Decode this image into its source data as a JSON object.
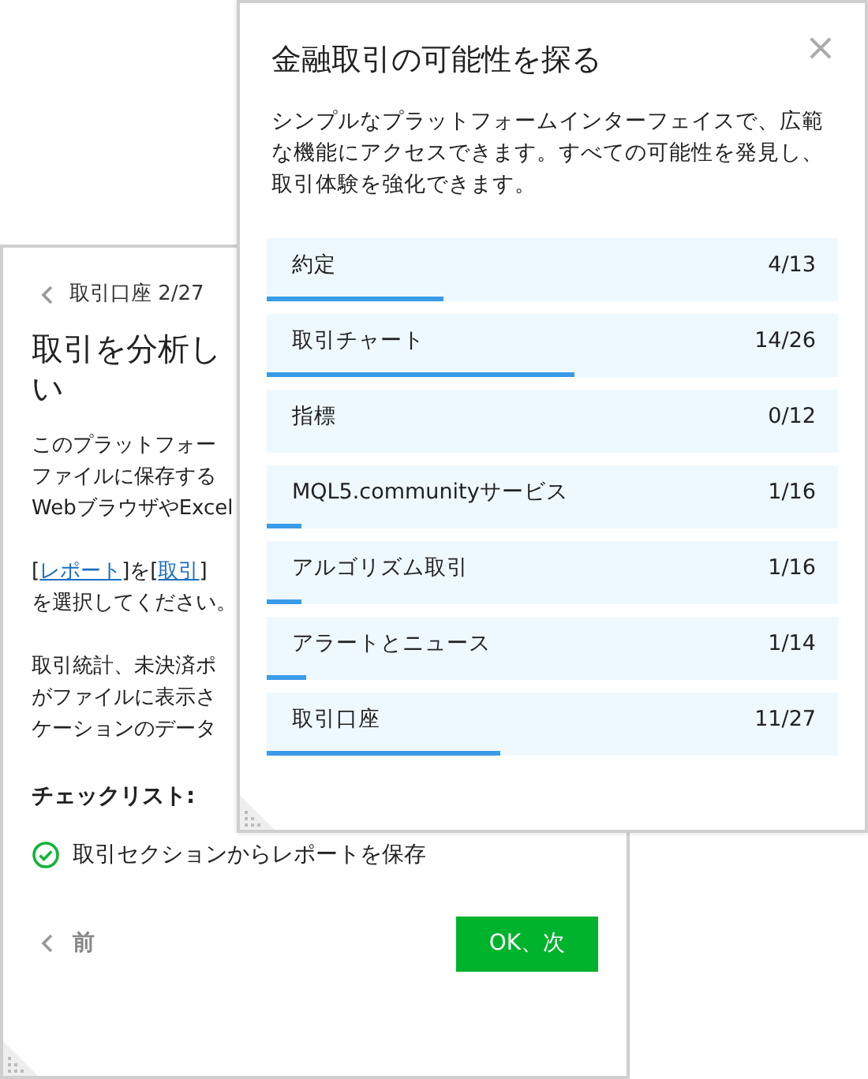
{
  "back_dialog": {
    "breadcrumb": "取引口座 2/27",
    "title_lines": [
      "取引を分析し",
      "い"
    ],
    "paragraphs": [
      {
        "lines": [
          [
            {
              "text": "このプラットフォー"
            }
          ],
          [
            {
              "text": "ファイルに保存する"
            }
          ],
          [
            {
              "text": "WebブラウザやExcel"
            }
          ]
        ]
      },
      {
        "lines": [
          [
            {
              "text": "["
            },
            {
              "text": "レポート",
              "kind": "link"
            },
            {
              "text": "]を["
            },
            {
              "text": "取引",
              "kind": "link"
            },
            {
              "text": "]"
            }
          ],
          [
            {
              "text": "を選択してください。"
            }
          ]
        ]
      },
      {
        "lines": [
          [
            {
              "text": "取引統計、未決済ポ"
            }
          ],
          [
            {
              "text": "がファイルに表示さ"
            }
          ],
          [
            {
              "text": "ケーションのデータ"
            }
          ]
        ]
      }
    ],
    "checklist_title": "チェックリスト:",
    "checklist": [
      {
        "label": "取引セクションからレポートを保存",
        "checked": true
      }
    ],
    "prev_button": "前",
    "next_button": "OK、次"
  },
  "front_dialog": {
    "title": "金融取引の可能性を探る",
    "close": "×",
    "description": "シンプルなプラットフォームインターフェイスで、広範な機能にアクセスできます。すべての可能性を発見し、取引体験を強化できます。",
    "topics": [
      {
        "label": "約定",
        "count": "4/13",
        "level": 0.31
      },
      {
        "label": "取引チャート",
        "count": "14/26",
        "level": 0.54
      },
      {
        "label": "指標",
        "count": "0/12",
        "level": 0
      },
      {
        "label": "MQL5.communityサービス",
        "count": "1/16",
        "level": 0.06
      },
      {
        "label": "アルゴリズム取引",
        "count": "1/16",
        "level": 0.06
      },
      {
        "label": "アラートとニュース",
        "count": "1/14",
        "level": 0.07
      },
      {
        "label": "取引口座",
        "count": "11/27",
        "level": 0.41
      }
    ]
  }
}
